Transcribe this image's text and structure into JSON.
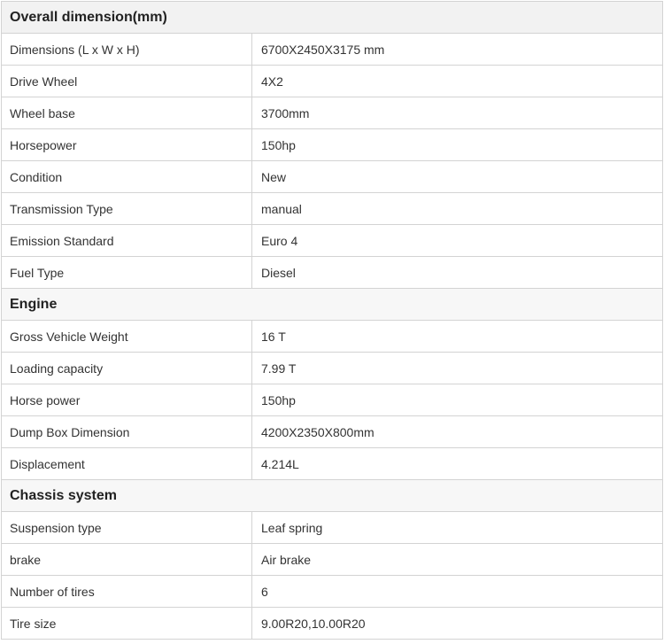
{
  "sections": [
    {
      "title": "Overall dimension(mm)",
      "rows": [
        {
          "label": "Dimensions (L x W x H)",
          "value": "6700X2450X3175 mm"
        },
        {
          "label": "Drive Wheel",
          "value": "4X2"
        },
        {
          "label": "Wheel base",
          "value": "3700mm"
        },
        {
          "label": "Horsepower",
          "value": "150hp"
        },
        {
          "label": "Condition",
          "value": "New"
        },
        {
          "label": "Transmission Type",
          "value": "manual"
        },
        {
          "label": "Emission Standard",
          "value": "Euro 4"
        },
        {
          "label": "Fuel Type",
          "value": "Diesel"
        }
      ]
    },
    {
      "title": "Engine",
      "rows": [
        {
          "label": "Gross Vehicle Weight",
          "value": "16 T"
        },
        {
          "label": "Loading capacity",
          "value": "7.99 T"
        },
        {
          "label": "Horse power",
          "value": "150hp"
        },
        {
          "label": "Dump Box Dimension",
          "value": "4200X2350X800mm"
        },
        {
          "label": "Displacement",
          "value": "4.214L"
        }
      ]
    },
    {
      "title": "Chassis system",
      "rows": [
        {
          "label": "Suspension type",
          "value": "Leaf spring"
        },
        {
          "label": "brake",
          "value": "Air brake"
        },
        {
          "label": "Number of tires",
          "value": "6"
        },
        {
          "label": "Tire size",
          "value": "9.00R20,10.00R20"
        }
      ]
    }
  ]
}
